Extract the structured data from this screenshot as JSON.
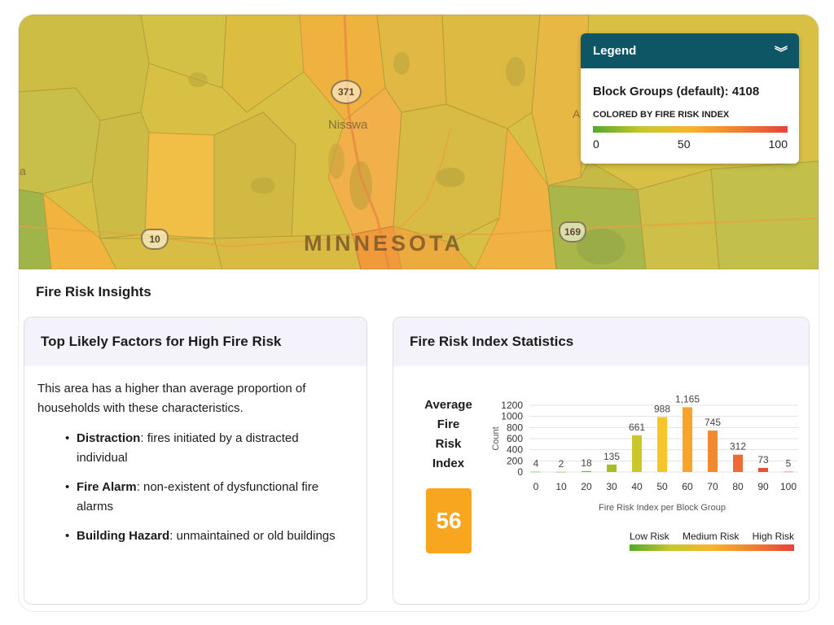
{
  "map": {
    "region_label": "MINNESOTA",
    "town_label": "Nisswa",
    "partial_label": "a",
    "partial_label_right": "A",
    "highways": [
      {
        "type": "state",
        "number": "371"
      },
      {
        "type": "us",
        "number": "10"
      },
      {
        "type": "us",
        "number": "169"
      }
    ]
  },
  "legend": {
    "title": "Legend",
    "collapse_icon": "double-chevron-down-icon",
    "count_text": "Block Groups (default): 4108",
    "subtitle": "COLORED BY FIRE RISK INDEX",
    "ticks": [
      "0",
      "50",
      "100"
    ],
    "gradient_colors": [
      "#4faa2a",
      "#c9c72a",
      "#f6b52a",
      "#f08030",
      "#e8413f"
    ]
  },
  "insights": {
    "title": "Fire Risk Insights",
    "factors_card": {
      "title": "Top Likely Factors for High Fire Risk",
      "intro": "This area has a higher than average proportion of households with these characteristics.",
      "factors": [
        {
          "name": "Distraction",
          "desc": ": fires initiated by a distracted individual"
        },
        {
          "name": "Fire Alarm",
          "desc": ": non-existent of dysfunctional fire alarms"
        },
        {
          "name": "Building Hazard",
          "desc": ": unmaintained or old buildings"
        }
      ]
    },
    "stats_card": {
      "title": "Fire Risk Index Statistics",
      "average_label_lines": [
        "Average",
        "Fire",
        "Risk",
        "Index"
      ],
      "average_value": "56",
      "risk_labels": [
        "Low Risk",
        "Medium Risk",
        "High Risk"
      ]
    }
  },
  "chart_data": {
    "type": "bar",
    "categories": [
      "0",
      "10",
      "20",
      "30",
      "40",
      "50",
      "60",
      "70",
      "80",
      "90",
      "100"
    ],
    "values": [
      4,
      2,
      18,
      135,
      661,
      988,
      1165,
      745,
      312,
      73,
      5
    ],
    "value_labels": [
      "4",
      "2",
      "18",
      "135",
      "661",
      "988",
      "1,165",
      "745",
      "312",
      "73",
      "5"
    ],
    "bar_colors": [
      "#4faa2a",
      "#5fae2a",
      "#86b82a",
      "#a9bd2a",
      "#c9c72a",
      "#f6c52a",
      "#f6a52a",
      "#f08a30",
      "#ee6b35",
      "#ea5039",
      "#e8413f"
    ],
    "xlabel": "Fire Risk Index per Block Group",
    "ylabel": "Count",
    "ylim": [
      0,
      1200
    ],
    "yticks": [
      "0",
      "200",
      "400",
      "600",
      "800",
      "1000",
      "1200"
    ],
    "grid": true
  }
}
